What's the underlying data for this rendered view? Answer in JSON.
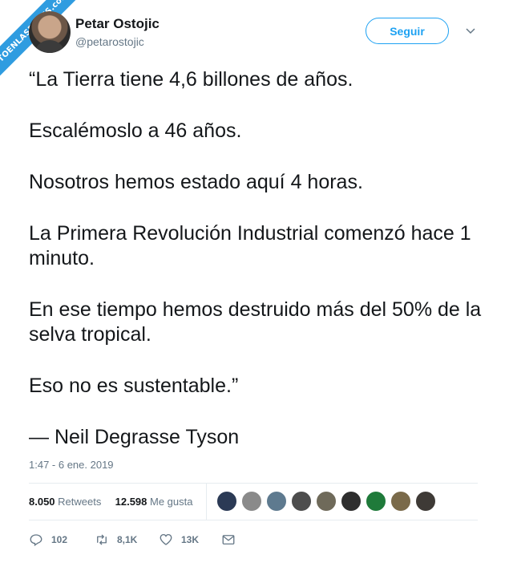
{
  "watermark": {
    "text": "VISTOENLASREDES.com"
  },
  "author": {
    "name": "Petar Ostojic",
    "handle": "@petarostojic"
  },
  "follow_button": {
    "label": "Seguir"
  },
  "tweet": {
    "paragraphs": [
      "“La Tierra tiene 4,6 billones de años.",
      "Escalémoslo a 46 años.",
      "Nosotros hemos estado aquí 4 horas.",
      "La Primera Revolución Industrial comenzó hace 1 minuto.",
      "En ese tiempo hemos destruido más del 50% de la selva tropical.",
      "Eso no es sustentable.”",
      "— Neil Degrasse Tyson"
    ],
    "timestamp": "1:47 - 6 ene. 2019"
  },
  "stats": {
    "retweets_count": "8.050",
    "retweets_label": "Retweets",
    "likes_count": "12.598",
    "likes_label": "Me gusta"
  },
  "likers": [
    "#2b3a55",
    "#8a8a8a",
    "#5e7a8f",
    "#4d4d4d",
    "#6f6a5a",
    "#2e2e2e",
    "#1f7a3a",
    "#7a6a4a",
    "#3e3a36"
  ],
  "actions": {
    "replies": "102",
    "retweets": "8,1K",
    "likes": "13K"
  },
  "colors": {
    "accent": "#1da1f2",
    "muted": "#657786",
    "text": "#14171a",
    "watermark": "#2f9ce0"
  }
}
